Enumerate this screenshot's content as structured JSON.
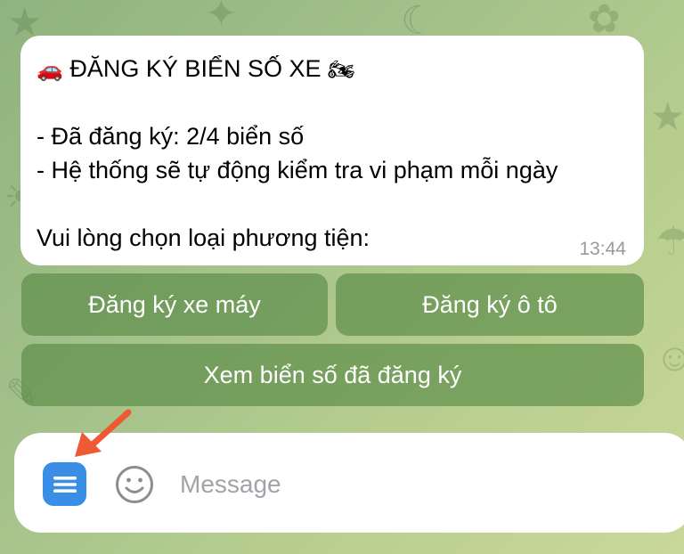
{
  "message": {
    "title_emoji_left": "🚗",
    "title": "ĐĂNG KÝ BIỂN SỐ XE",
    "title_emoji_right": "🏍",
    "line1": "- Đã đăng ký: 2/4 biển số",
    "line2": "- Hệ thống sẽ tự động kiểm tra vi phạm mỗi ngày",
    "prompt": "Vui lòng chọn loại phương tiện:",
    "time": "13:44"
  },
  "keyboard": {
    "motorbike_label": "Đăng ký xe máy",
    "car_label": "Đăng ký ô tô",
    "view_label": "Xem biển số đã đăng ký"
  },
  "composer": {
    "placeholder": "Message",
    "menu_button_icon": "menu-icon",
    "emoji_button_icon": "smiley-icon"
  },
  "colors": {
    "menu_button": "#3a8ee6",
    "arrow": "#ef5a35",
    "keyboard_button": "#5c8c48"
  }
}
